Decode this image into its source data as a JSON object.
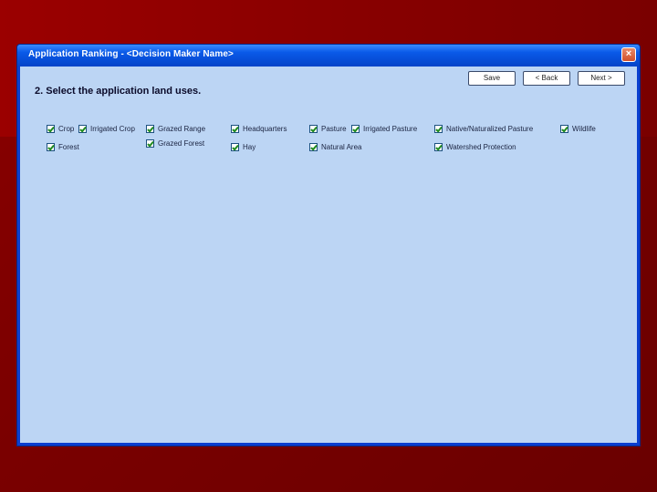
{
  "window": {
    "title": "Application Ranking - <Decision Maker Name>",
    "close_symbol": "×"
  },
  "toolbar": {
    "save_label": "Save",
    "back_label": "< Back",
    "next_label": "Next >"
  },
  "main": {
    "heading": "2. Select the application land uses."
  },
  "land_uses": [
    {
      "label": "Crop",
      "checked": true
    },
    {
      "label": "Irrigated Crop",
      "checked": true
    },
    {
      "label": "Grazed Range",
      "checked": true
    },
    {
      "label": "Headquarters",
      "checked": true
    },
    {
      "label": "Pasture",
      "checked": true
    },
    {
      "label": "Irrigated Pasture",
      "checked": true
    },
    {
      "label": "Native/Naturalized Pasture",
      "checked": true
    },
    {
      "label": "Wildlife",
      "checked": true
    },
    {
      "label": "Forest",
      "checked": true
    },
    {
      "label": "Grazed Forest",
      "checked": true
    },
    {
      "label": "Hay",
      "checked": true
    },
    {
      "label": "Natural Area",
      "checked": true
    },
    {
      "label": "Watershed Protection",
      "checked": true
    }
  ],
  "colors": {
    "background": "#7a0000",
    "titlebar": "#0a5ae8",
    "client": "#bcd5f4",
    "checkmark": "#1f8a1f"
  }
}
